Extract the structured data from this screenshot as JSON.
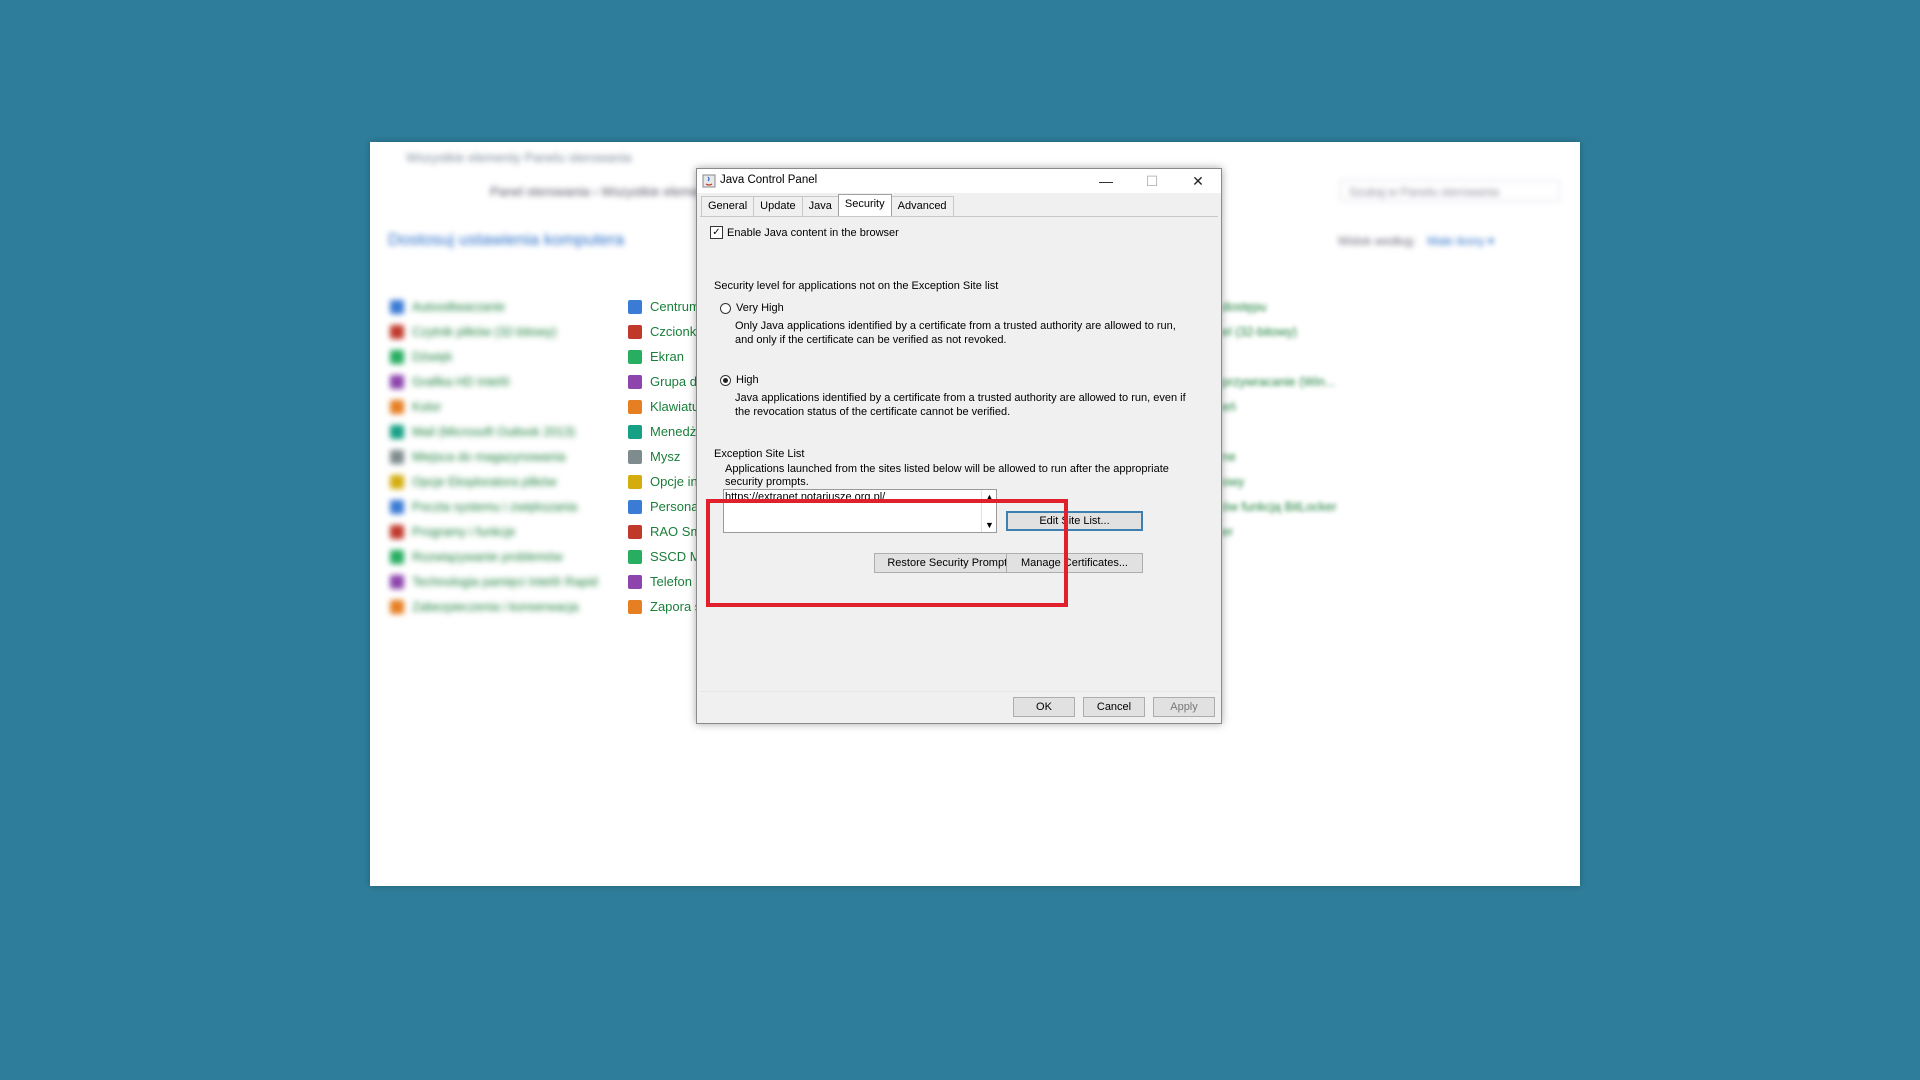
{
  "background_window": {
    "title": "Wszystkie elementy Panelu sterowania",
    "breadcrumb": "Panel sterowania  ›  Wszystkie elementy Panelu sterowania",
    "search_placeholder": "Szukaj w Panelu sterowania",
    "heading": "Dostosuj ustawienia komputera",
    "view_by_label": "Widok według:",
    "view_by_value": "Małe ikony ▾",
    "col1": [
      "Autoodtwarzanie",
      "Czytnik plików (32-bitowy)",
      "Dźwięk",
      "Grafika HD Intel®",
      "Kolor",
      "Mail (Microsoft Outlook 2013)",
      "Miejsca do magazynowania",
      "Opcje Eksploratora plików",
      "Poczta systemu i zwiększania",
      "Programy i funkcje",
      "Rozwiązywanie problemów",
      "Technologia pamięci Intel® Rapid",
      "Zabezpieczenia i konserwacja"
    ],
    "col2": [
      "Centrum",
      "Czcionki",
      "Ekran",
      "Grupa do",
      "Klawiatu",
      "Menedże",
      "Mysz",
      "Opcje inc",
      "Personali",
      "RAO Sma",
      "SSCD Ma",
      "Telefon i",
      "Zapora sy"
    ],
    "col3": [
      "dostępu",
      "el (32-bitowy)",
      "",
      "przywracanie (Win...",
      "eń",
      "",
      "ne",
      "owy",
      "ów funkcją BitLocker",
      "er"
    ]
  },
  "dialog": {
    "title": "Java Control Panel",
    "tabs": [
      "General",
      "Update",
      "Java",
      "Security",
      "Advanced"
    ],
    "active_tab": "Security",
    "enable_java_label": "Enable Java content in the browser",
    "enable_java_checked": true,
    "security_level_label": "Security level for applications not on the Exception Site list",
    "very_high_label": "Very High",
    "very_high_desc": "Only Java applications identified by a certificate from a trusted authority are allowed to run, and only if the certificate can be verified as not revoked.",
    "high_label": "High",
    "high_desc": "Java applications identified by a certificate from a trusted authority are allowed to run, even if the revocation status of the certificate cannot be verified.",
    "selected_level": "High",
    "exception_title": "Exception Site List",
    "exception_desc": "Applications launched from the sites listed below will be allowed to run after the appropriate security prompts.",
    "exception_sites": [
      "https://extranet.notariusze.org.pl/"
    ],
    "edit_site_list_label": "Edit Site List...",
    "restore_prompts_label": "Restore Security Prompts",
    "manage_certs_label": "Manage Certificates...",
    "ok_label": "OK",
    "cancel_label": "Cancel",
    "apply_label": "Apply"
  },
  "colors": {
    "desktop": "#2e7d9a",
    "highlight": "#e0202a",
    "link_green": "#1a7f3a"
  }
}
